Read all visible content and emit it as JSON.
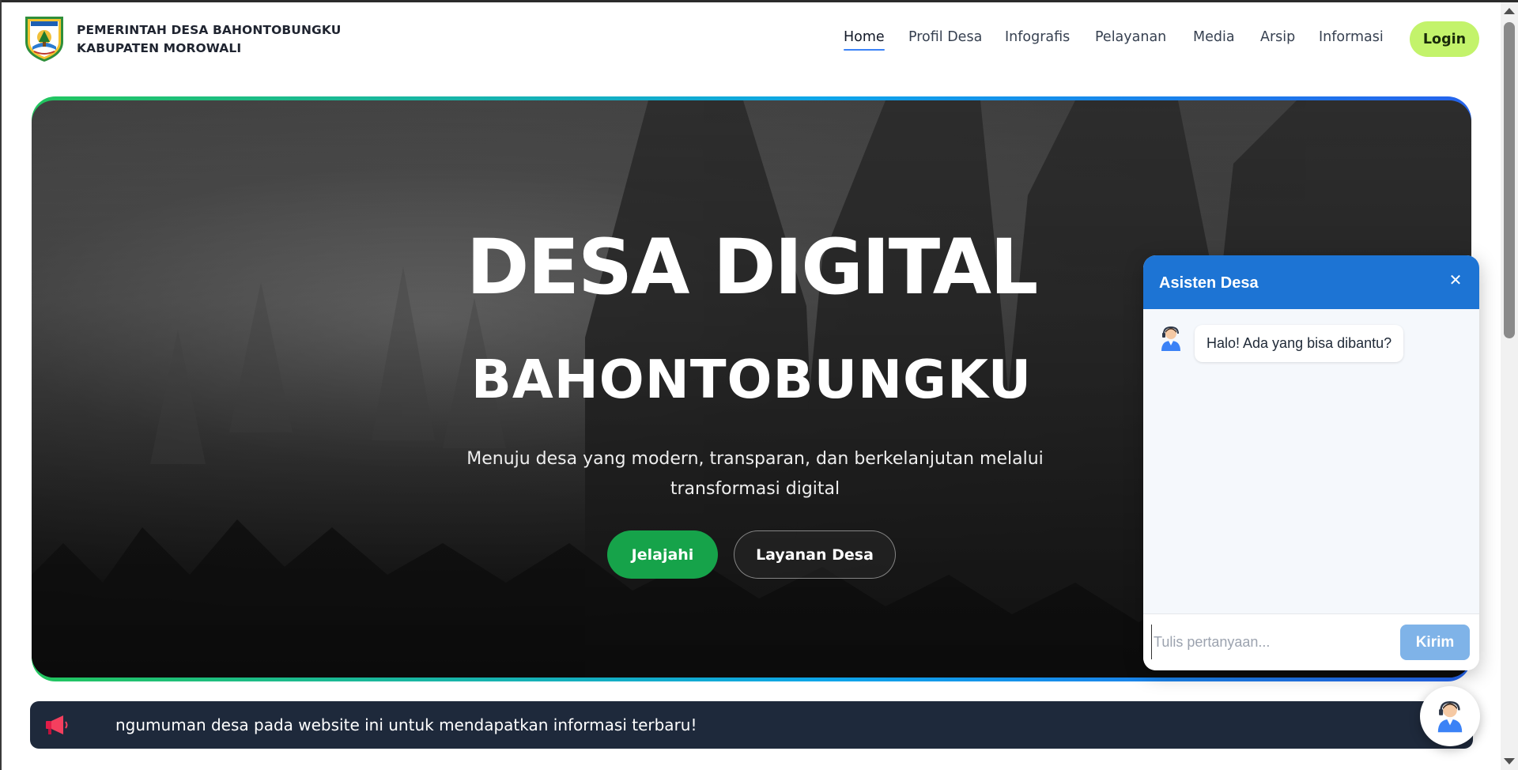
{
  "header": {
    "brand_line1": "PEMERINTAH DESA BAHONTOBUNGKU",
    "brand_line2": "KABUPATEN MOROWALI",
    "logo_icon": "village-emblem-icon",
    "nav": [
      {
        "label": "Home",
        "active": true
      },
      {
        "label": "Profil Desa",
        "active": false
      },
      {
        "label": "Infografis",
        "active": false
      },
      {
        "label": "Pelayanan",
        "active": false
      },
      {
        "label": "Media",
        "active": false
      },
      {
        "label": "Arsip",
        "active": false
      },
      {
        "label": "Informasi",
        "active": false
      }
    ],
    "login_label": "Login"
  },
  "hero": {
    "title": "DESA DIGITAL",
    "subtitle": "BAHONTOBUNGKU",
    "description": "Menuju desa yang modern, transparan, dan berkelanjutan melalui transformasi digital",
    "primary_button": "Jelajahi",
    "secondary_button": "Layanan Desa"
  },
  "announcement": {
    "icon": "megaphone-icon",
    "text": "ngumuman desa pada website ini untuk mendapatkan informasi terbaru!"
  },
  "chat": {
    "title": "Asisten Desa",
    "close_icon": "close-icon",
    "bot_avatar": "support-agent-icon",
    "messages": [
      {
        "from": "bot",
        "text": "Halo! Ada yang bisa dibantu?"
      }
    ],
    "input_placeholder": "Tulis pertanyaan...",
    "send_label": "Kirim"
  },
  "colors": {
    "login_bg": "#c3f36b",
    "primary_green": "#16a34a",
    "chat_header": "#1d74d4",
    "announce_bg": "#1e293b",
    "nav_active_underline": "#3b82f6"
  }
}
